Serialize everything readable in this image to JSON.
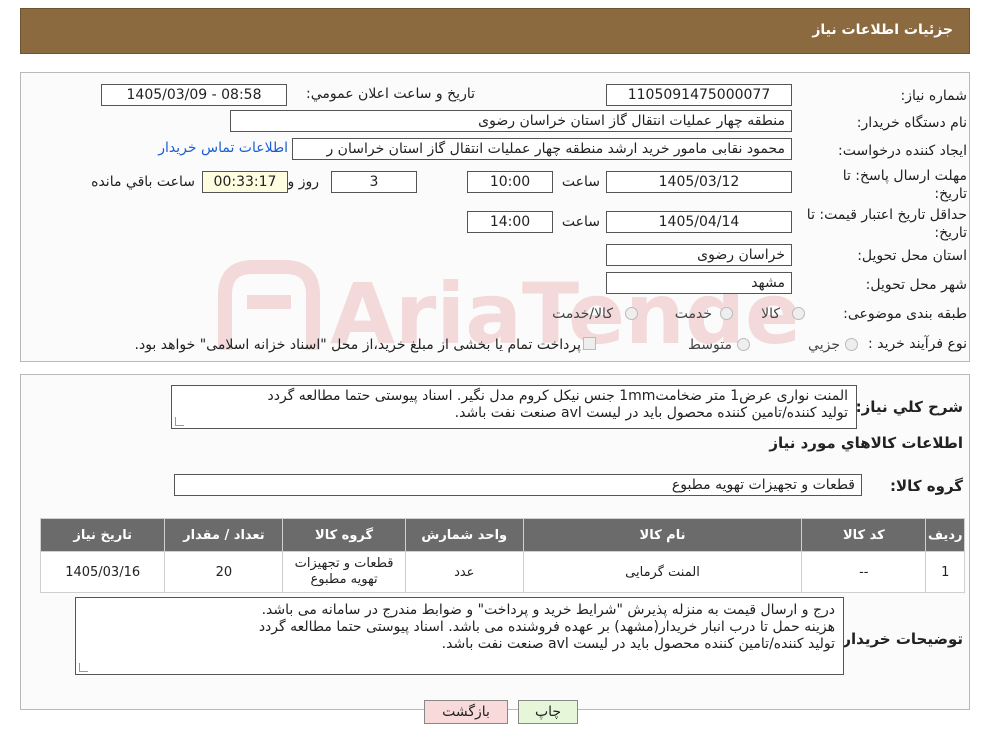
{
  "header": {
    "title": "جزئیات اطلاعات نیاز"
  },
  "watermark": {
    "text": "AriaTender.neT"
  },
  "info": {
    "need_number_label": "شماره نیاز:",
    "need_number": "1105091475000077",
    "announce_label": "تاریخ و ساعت اعلان عمومي:",
    "announce_value": "1405/03/09 - 08:58",
    "buyer_org_label": "نام دستگاه خريدار:",
    "buyer_org": "منطقه چهار عمليات انتقال گاز   استان خراسان رضوی",
    "creator_label": "ايجاد کننده درخواست:",
    "creator": "محمود نقابی مامور خريد ارشد منطقه چهار عمليات انتقال گاز   استان خراسان ر",
    "contact_link": "اطلاعات تماس خريدار",
    "deadline_label": "مهلت ارسال پاسخ: تا تاريخ:",
    "deadline_date": "1405/03/12",
    "time_label": "ساعت",
    "deadline_time": "10:00",
    "days_value": "3",
    "days_label": "روز و",
    "remaining_time": "00:33:17",
    "remaining_label": "ساعت باقي مانده",
    "validity_label": "حداقل تاريخ اعتبار قيمت: تا تاريخ:",
    "validity_date": "1405/04/14",
    "validity_time": "14:00",
    "province_label": "استان محل تحويل:",
    "province": "خراسان رضوی",
    "city_label": "شهر محل تحويل:",
    "city": "مشهد",
    "category_label": "طبقه بندی موضوعی:",
    "category_options": [
      "کالا",
      "خدمت",
      "کالا/خدمت"
    ],
    "process_label": "نوع فرآيند خريد :",
    "process_options": [
      "جزيي",
      "متوسط"
    ],
    "process_note": "پرداخت تمام يا بخشی از مبلغ خريد،از محل \"اسناد خزانه اسلامی\" خواهد بود."
  },
  "summary": {
    "label": "شرح کلي نياز:",
    "line1": "المنت نواری عرض1 متر ضخامت1mm جنس نيکل کروم مدل نگير. اسناد پيوستی حتما مطالعه گردد",
    "line2": "توليد کننده/تامين کننده محصول بايد در ليست avl صنعت نفت باشد."
  },
  "goods": {
    "section_title": "اطلاعات کالاهاي مورد نياز",
    "group_label": "گروه کالا:",
    "group_value": "قطعات و تجهيزات تهويه مطبوع",
    "columns": [
      "رديف",
      "کد کالا",
      "نام کالا",
      "واحد شمارش",
      "گروه کالا",
      "تعداد / مقدار",
      "تاريخ نياز"
    ],
    "rows": [
      [
        "1",
        "--",
        "المنت گرمايی",
        "عدد",
        "قطعات و تجهيزات تهويه مطبوع",
        "20",
        "1405/03/16"
      ]
    ]
  },
  "buyer_notes": {
    "label": "توضيحات خريدار:",
    "line1": "درج و ارسال قيمت به منزله پذيرش \"شرايط خريد و پرداخت\" و ضوابط مندرج در سامانه می باشد.",
    "line2": "هزينه حمل تا درب انبار خريدار(مشهد) بر عهده فروشنده می باشد. اسناد پيوستی حتما مطالعه گردد",
    "line3": "توليد کننده/تامين کننده محصول بايد در ليست avl صنعت نفت باشد."
  },
  "buttons": {
    "print": "چاپ",
    "back": "بازگشت"
  },
  "colors": {
    "header": "#8b6a3f",
    "print_btn": "#e6f6d9",
    "back_btn": "#f9dada",
    "link": "#1a5fd0"
  }
}
